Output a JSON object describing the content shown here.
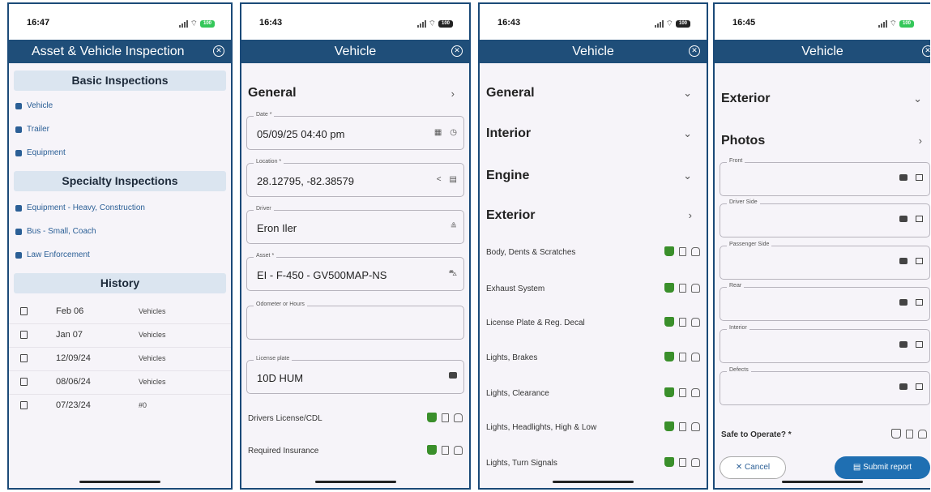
{
  "screens": [
    {
      "time": "16:47",
      "battery": "100",
      "title": "Asset & Vehicle Inspection",
      "basic_header": "Basic Inspections",
      "basic_items": [
        "Vehicle",
        "Trailer",
        "Equipment"
      ],
      "specialty_header": "Specialty Inspections",
      "specialty_items": [
        "Equipment - Heavy, Construction",
        "Bus - Small, Coach",
        "Law Enforcement"
      ],
      "history_header": "History",
      "history": [
        {
          "date": "Feb 06",
          "type": "Vehicles"
        },
        {
          "date": "Jan 07",
          "type": "Vehicles"
        },
        {
          "date": "12/09/24",
          "type": "Vehicles"
        },
        {
          "date": "08/06/24",
          "type": "Vehicles"
        },
        {
          "date": "07/23/24",
          "type": "#0"
        }
      ]
    },
    {
      "time": "16:43",
      "battery": "100",
      "title": "Vehicle",
      "section": "General",
      "fields": [
        {
          "label": "Date *",
          "value": "05/09/25 04:40 pm"
        },
        {
          "label": "Location *",
          "value": "28.12795, -82.38579"
        },
        {
          "label": "Driver",
          "value": "Eron Iler"
        },
        {
          "label": "Asset *",
          "value": "EI - F-450 - GV500MAP-NS"
        },
        {
          "label": "Odometer or Hours",
          "value": ""
        },
        {
          "label": "License plate",
          "value": "10D HUM"
        }
      ],
      "checks": [
        "Drivers License/CDL",
        "Required Insurance"
      ]
    },
    {
      "time": "16:43",
      "battery": "100",
      "title": "Vehicle",
      "sections": [
        "General",
        "Interior",
        "Engine",
        "Exterior"
      ],
      "checks": [
        "Body, Dents & Scratches",
        "Exhaust System",
        "License Plate & Reg. Decal",
        "Lights, Brakes",
        "Lights, Clearance",
        "Lights, Headlights, High & Low",
        "Lights, Turn Signals"
      ]
    },
    {
      "time": "16:45",
      "battery": "100",
      "title": "Vehicle",
      "sections": [
        "Exterior",
        "Photos"
      ],
      "photo_fields": [
        "Front",
        "Driver Side",
        "Passenger Side",
        "Rear",
        "Interior",
        "Defects"
      ],
      "safe_label": "Safe to Operate? *",
      "cancel_label": "Cancel",
      "submit_label": "Submit report"
    }
  ]
}
